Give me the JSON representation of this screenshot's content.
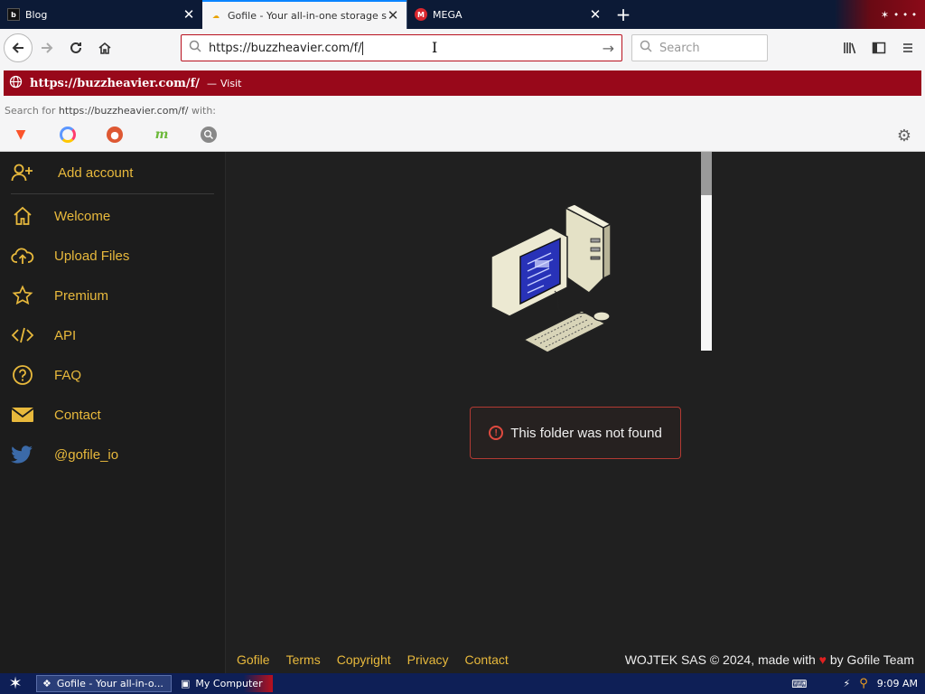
{
  "tabs": [
    {
      "title": "Blog",
      "active": false
    },
    {
      "title": "Gofile - Your all-in-one storage so",
      "active": true
    },
    {
      "title": "MEGA",
      "active": false
    }
  ],
  "tab_close_glyph": "✕",
  "new_tab_glyph": "+",
  "address": {
    "value": "https://buzzheavier.com/f/",
    "go_glyph": "→"
  },
  "search": {
    "placeholder": "Search"
  },
  "suggestion": {
    "url": "https://buzzheavier.com/f/",
    "separator": "—",
    "action": "Visit"
  },
  "search_for": {
    "prefix": "Search for",
    "query": "https://buzzheavier.com/f/",
    "suffix": "with:"
  },
  "engines": [
    {
      "name": "brave",
      "glyph": "▼"
    },
    {
      "name": "qwant",
      "glyph": ""
    },
    {
      "name": "duckduckgo",
      "glyph": "●"
    },
    {
      "name": "mojeek",
      "glyph": "m"
    },
    {
      "name": "other",
      "glyph": "🔍"
    }
  ],
  "sidebar": {
    "add_account": "Add account",
    "items": [
      {
        "label": "Welcome",
        "icon": "home-icon"
      },
      {
        "label": "Upload Files",
        "icon": "cloud-upload-icon"
      },
      {
        "label": "Premium",
        "icon": "star-icon"
      },
      {
        "label": "API",
        "icon": "code-icon"
      },
      {
        "label": "FAQ",
        "icon": "question-icon"
      },
      {
        "label": "Contact",
        "icon": "envelope-icon"
      },
      {
        "label": "@gofile_io",
        "icon": "twitter-icon"
      }
    ]
  },
  "main": {
    "error_message": "This folder was not found"
  },
  "footer": {
    "links": [
      "Gofile",
      "Terms",
      "Copyright",
      "Privacy",
      "Contact"
    ],
    "credit_prefix": "WOJTEK SAS © 2024, made with",
    "credit_suffix": "by Gofile Team"
  },
  "taskbar": {
    "tasks": [
      {
        "label": "Gofile - Your all-in-o...",
        "active": true
      },
      {
        "label": "My Computer",
        "active": false
      }
    ],
    "clock": "9:09 AM"
  },
  "colors": {
    "accent": "#e8b93c",
    "suggestion_bar": "#98081a",
    "error_border": "#b23a33",
    "taskbar": "#0e1f56"
  }
}
